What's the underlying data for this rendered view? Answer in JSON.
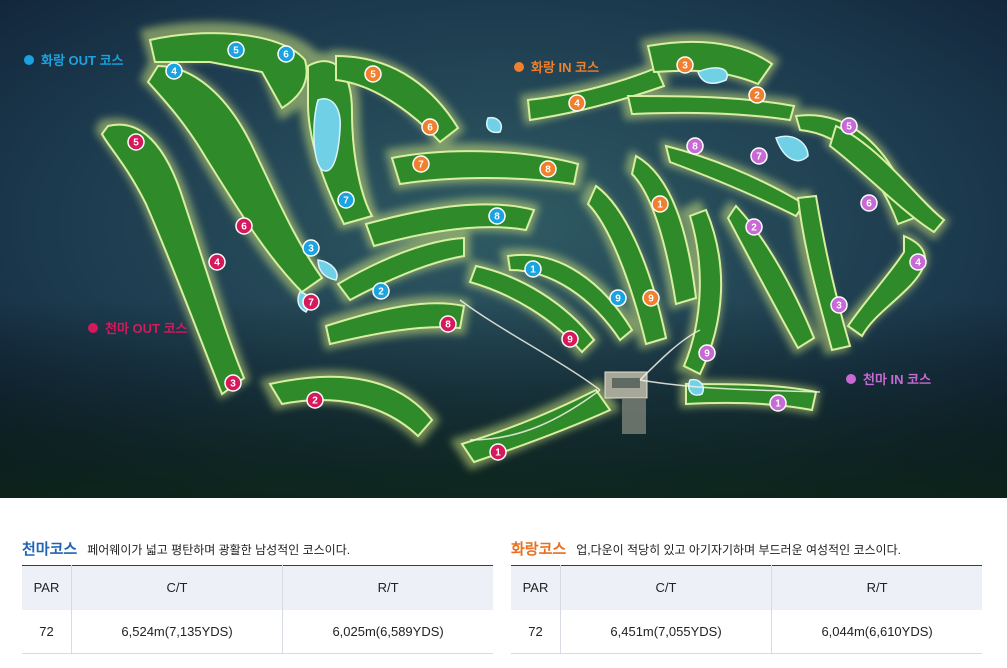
{
  "map": {
    "legends": {
      "hwarang_out": {
        "label": "화랑 OUT 코스",
        "color": "#1aa3e0"
      },
      "hwarang_in": {
        "label": "화랑 IN 코스",
        "color": "#f07f2e"
      },
      "chunma_out": {
        "label": "천마 OUT 코스",
        "color": "#d6195b"
      },
      "chunma_in": {
        "label": "천마 IN 코스",
        "color": "#c76ad6"
      }
    },
    "holes": {
      "hwarang_out": [
        "1",
        "2",
        "3",
        "4",
        "5",
        "6",
        "7",
        "8",
        "9"
      ],
      "hwarang_in": [
        "1",
        "2",
        "3",
        "4",
        "5",
        "6",
        "7",
        "8",
        "9"
      ],
      "chunma_out": [
        "1",
        "2",
        "3",
        "4",
        "5",
        "6",
        "7",
        "8",
        "9"
      ],
      "chunma_in": [
        "1",
        "2",
        "3",
        "4",
        "5",
        "6",
        "7",
        "8",
        "9"
      ]
    }
  },
  "courses": [
    {
      "title": "천마코스",
      "title_color": "#1f63b5",
      "description": "페어웨이가 넓고 평탄하며 광활한 남성적인 코스이다.",
      "headers": [
        "PAR",
        "C/T",
        "R/T"
      ],
      "values": [
        "72",
        "6,524m(7,135YDS)",
        "6,025m(6,589YDS)"
      ]
    },
    {
      "title": "화랑코스",
      "title_color": "#e8701f",
      "description": "업,다운이 적당히 있고 아기자기하며 부드러운 여성적인 코스이다.",
      "headers": [
        "PAR",
        "C/T",
        "R/T"
      ],
      "values": [
        "72",
        "6,451m(7,055YDS)",
        "6,044m(6,610YDS)"
      ]
    }
  ]
}
